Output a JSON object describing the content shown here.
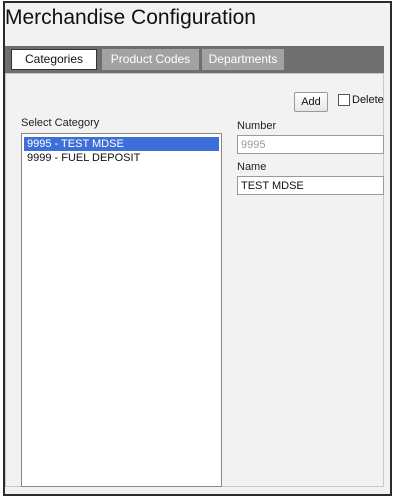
{
  "window": {
    "title": "Merchandise Configuration"
  },
  "tabs": [
    {
      "label": "Categories",
      "active": true
    },
    {
      "label": "Product Codes",
      "active": false
    },
    {
      "label": "Departments",
      "active": false
    }
  ],
  "toolbar": {
    "add_label": "Add",
    "delete_label": "Delete",
    "delete_checked": false
  },
  "category_list": {
    "label": "Select Category",
    "items": [
      {
        "text": "9995 - TEST MDSE",
        "selected": true
      },
      {
        "text": "9999 - FUEL DEPOSIT",
        "selected": false
      }
    ]
  },
  "form": {
    "number_label": "Number",
    "number_value": "9995",
    "name_label": "Name",
    "name_value": "TEST MDSE"
  },
  "colors": {
    "selection": "#3d6fd8",
    "tab_bar": "#6f6f6f",
    "inactive_tab": "#a2a2a2",
    "background": "#f2f2f2"
  }
}
